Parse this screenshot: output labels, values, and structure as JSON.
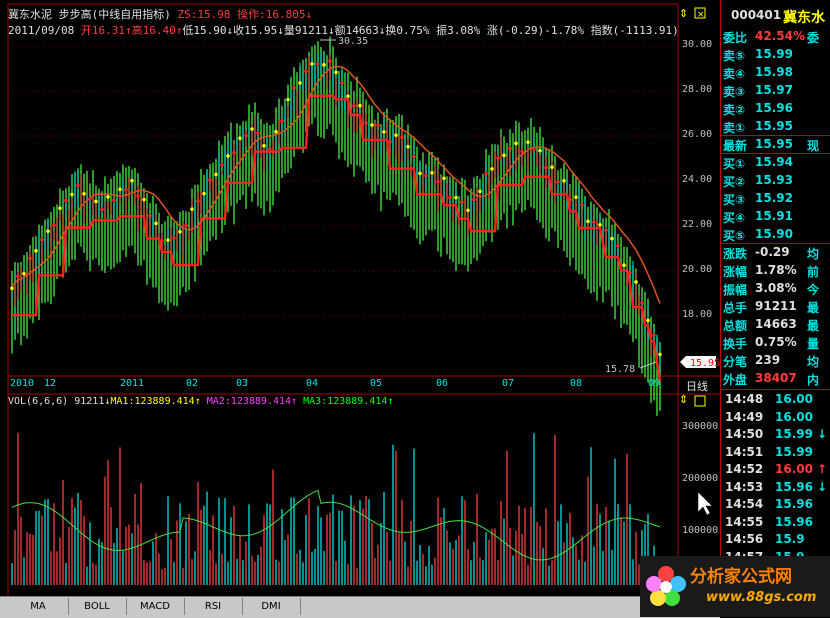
{
  "stock_name": "冀东水泥",
  "formula": "步步高(中线自用指标)",
  "zs_label": "ZS:",
  "zs_value": "15.98",
  "op_label": "操作:",
  "op_value": "16.805",
  "date": "2011/09/08",
  "open_label": "开",
  "open": "16.31",
  "high_label": "高",
  "high": "16.40",
  "low_label": "低",
  "low": "15.90",
  "close_label": "收",
  "close": "15.95",
  "vol_label": "量",
  "vol": "91211",
  "amt_label": "额",
  "amt": "14663",
  "turn_label": "换",
  "turn": "0.75%",
  "amp_label": "振",
  "amp": "3.08%",
  "chg_label": "涨",
  "chg": "(-0.29)-1.78%",
  "idx_label": "指数",
  "idx": "(-1113.91)",
  "max_label": "30.35",
  "min_label": "15.78",
  "price_ticks": [
    "30.00",
    "28.00",
    "26.00",
    "24.00",
    "22.00",
    "20.00",
    "18.00"
  ],
  "cur_price_tag": "15.95",
  "date_labels": [
    "2010",
    "12",
    "2011",
    "02",
    "03",
    "04",
    "05",
    "06",
    "07",
    "08",
    "09"
  ],
  "period": "日线",
  "vol_header": {
    "name": "VOL(6,6,6)",
    "v": "91211",
    "ma1": "MA1:123889.414",
    "ma2": "MA2:123889.414",
    "ma3": "MA3:123889.414"
  },
  "vol_ticks": [
    "300000",
    "200000",
    "100000"
  ],
  "tabs": [
    "MA",
    "BOLL",
    "MACD",
    "RSI",
    "DMI"
  ],
  "right": {
    "code": "000401",
    "name": "冀东水",
    "ratio_label": "委比",
    "ratio": "42.54%",
    "ratio_ext": "委",
    "sells": [
      {
        "label": "卖⑤",
        "price": "15.99"
      },
      {
        "label": "卖④",
        "price": "15.98"
      },
      {
        "label": "卖③",
        "price": "15.97"
      },
      {
        "label": "卖②",
        "price": "15.96"
      },
      {
        "label": "卖①",
        "price": "15.95"
      }
    ],
    "last_label": "最新",
    "last": "15.95",
    "last_ext": "现",
    "buys": [
      {
        "label": "买①",
        "price": "15.94"
      },
      {
        "label": "买②",
        "price": "15.93"
      },
      {
        "label": "买③",
        "price": "15.92"
      },
      {
        "label": "买④",
        "price": "15.91"
      },
      {
        "label": "买⑤",
        "price": "15.90"
      }
    ],
    "stats": [
      {
        "label": "涨跌",
        "value": "-0.29",
        "ext": "均"
      },
      {
        "label": "涨幅",
        "value": "1.78%",
        "ext": "前"
      },
      {
        "label": "振幅",
        "value": "3.08%",
        "ext": "今"
      },
      {
        "label": "总手",
        "value": "91211",
        "ext": "最"
      },
      {
        "label": "总额",
        "value": "14663",
        "ext": "最"
      },
      {
        "label": "换手",
        "value": "0.75%",
        "ext": "量"
      },
      {
        "label": "分笔",
        "value": "239",
        "ext": "均"
      },
      {
        "label": "外盘",
        "value": "38407",
        "ext": "内"
      }
    ],
    "ticks": [
      {
        "time": "14:48",
        "price": "16.00",
        "arrow": ""
      },
      {
        "time": "14:49",
        "price": "16.00",
        "arrow": ""
      },
      {
        "time": "14:50",
        "price": "15.99",
        "arrow": "↓"
      },
      {
        "time": "14:51",
        "price": "15.99",
        "arrow": ""
      },
      {
        "time": "14:52",
        "price": "16.00",
        "arrow": "↑"
      },
      {
        "time": "14:53",
        "price": "15.96",
        "arrow": "↓"
      },
      {
        "time": "14:54",
        "price": "15.96",
        "arrow": ""
      },
      {
        "time": "14:55",
        "price": "15.96",
        "arrow": ""
      },
      {
        "time": "14:56",
        "price": "15.9",
        "arrow": ""
      },
      {
        "time": "14:57",
        "price": "15.9",
        "arrow": ""
      }
    ]
  },
  "watermark": {
    "title": "分析家公式网",
    "url": "www.88gs.com"
  },
  "colors": {
    "up": "#ff3c3c",
    "down": "#00e0e0",
    "green_bar": "#40e040",
    "line_red": "#ff2020",
    "dot_yellow": "#ffff00",
    "dot_red": "#ff2020",
    "grid": "#a00000",
    "ma": "#40e040"
  }
}
